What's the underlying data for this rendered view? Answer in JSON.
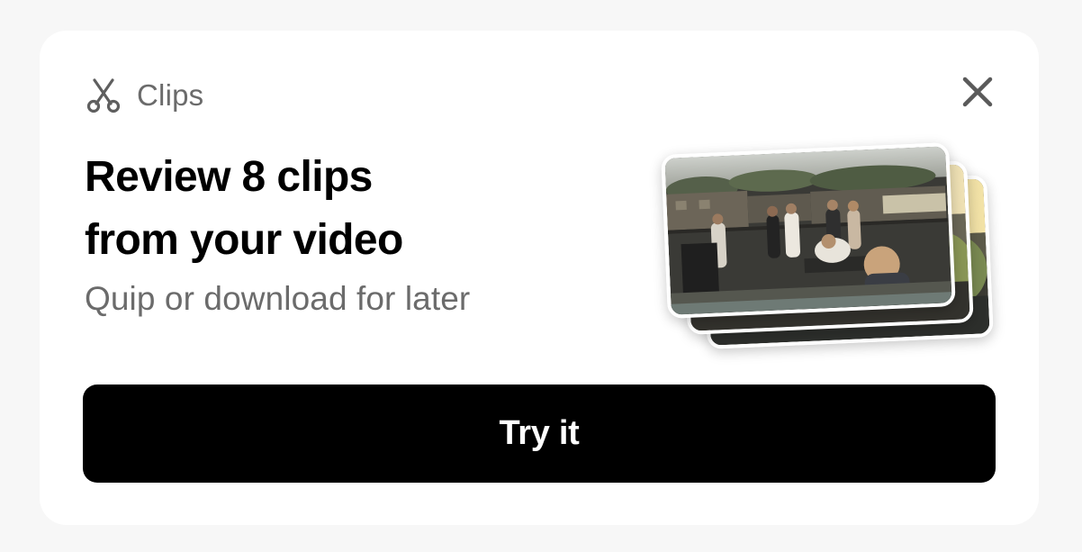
{
  "header": {
    "icon": "scissors-icon",
    "label": "Clips"
  },
  "close": {
    "icon": "close-icon"
  },
  "headline": {
    "line1": "Review 8 clips",
    "line2": "from your video"
  },
  "subtitle": "Quip or download for later",
  "thumbnails": {
    "count": 3,
    "description_icon": "video-clip-thumbnail"
  },
  "cta": {
    "label": "Try it"
  },
  "colors": {
    "background": "#f7f7f7",
    "card": "#ffffff",
    "primary_text": "#000000",
    "secondary_text": "#6b6b6b",
    "cta_background": "#000000",
    "cta_text": "#ffffff"
  }
}
